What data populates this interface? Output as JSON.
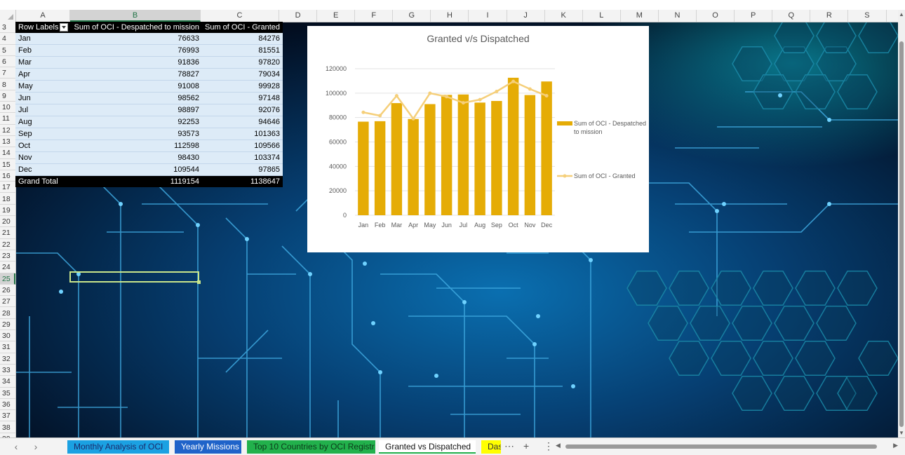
{
  "columns": [
    "A",
    "B",
    "C",
    "D",
    "E",
    "F",
    "G",
    "H",
    "I",
    "J",
    "K",
    "L",
    "M",
    "N",
    "O",
    "P",
    "Q",
    "R",
    "S"
  ],
  "rows": [
    "3",
    "4",
    "5",
    "6",
    "7",
    "8",
    "9",
    "10",
    "11",
    "12",
    "13",
    "14",
    "15",
    "16",
    "17",
    "18",
    "19",
    "20",
    "21",
    "22",
    "23",
    "24",
    "25",
    "26",
    "27",
    "28",
    "29",
    "30",
    "31",
    "32",
    "33",
    "34",
    "35",
    "36",
    "37",
    "38",
    "39"
  ],
  "selected_column": "B",
  "selected_row": "25",
  "pivot": {
    "headers": [
      "Row Labels",
      "Sum of OCI - Despatched to mission",
      "Sum of OCI - Granted"
    ],
    "rows": [
      {
        "label": "Jan",
        "despatched": "76633",
        "granted": "84276"
      },
      {
        "label": "Feb",
        "despatched": "76993",
        "granted": "81551"
      },
      {
        "label": "Mar",
        "despatched": "91836",
        "granted": "97820"
      },
      {
        "label": "Apr",
        "despatched": "78827",
        "granted": "79034"
      },
      {
        "label": "May",
        "despatched": "91008",
        "granted": "99928"
      },
      {
        "label": "Jun",
        "despatched": "98562",
        "granted": "97148"
      },
      {
        "label": "Jul",
        "despatched": "98897",
        "granted": "92076"
      },
      {
        "label": "Aug",
        "despatched": "92253",
        "granted": "94646"
      },
      {
        "label": "Sep",
        "despatched": "93573",
        "granted": "101363"
      },
      {
        "label": "Oct",
        "despatched": "112598",
        "granted": "109566"
      },
      {
        "label": "Nov",
        "despatched": "98430",
        "granted": "103374"
      },
      {
        "label": "Dec",
        "despatched": "109544",
        "granted": "97865"
      }
    ],
    "total": {
      "label": "Grand Total",
      "despatched": "1119154",
      "granted": "1138647"
    }
  },
  "chart_data": {
    "type": "bar",
    "title": "Granted v/s Dispatched",
    "categories": [
      "Jan",
      "Feb",
      "Mar",
      "Apr",
      "May",
      "Jun",
      "Jul",
      "Aug",
      "Sep",
      "Oct",
      "Nov",
      "Dec"
    ],
    "series": [
      {
        "name": "Sum of OCI - Despatched to mission",
        "kind": "bar",
        "color": "#e5ac06",
        "values": [
          76633,
          76993,
          91836,
          78827,
          91008,
          98562,
          98897,
          92253,
          93573,
          112598,
          98430,
          109544
        ]
      },
      {
        "name": "Sum of OCI - Granted",
        "kind": "line",
        "color": "#f5cf7a",
        "values": [
          84276,
          81551,
          97820,
          79034,
          99928,
          97148,
          92076,
          94646,
          101363,
          109566,
          103374,
          97865
        ]
      }
    ],
    "ylim": [
      0,
      120000
    ],
    "yticks": [
      0,
      20000,
      40000,
      60000,
      80000,
      100000,
      120000
    ],
    "grid": true,
    "legend": "right"
  },
  "tabs": [
    {
      "label": "Monthly Analysis of OCI",
      "style": "blue"
    },
    {
      "label": "Yearly Missions",
      "style": "navy"
    },
    {
      "label": "Top 10 Countries by OCI Registr",
      "style": "green"
    },
    {
      "label": "Granted vs Dispatched",
      "style": "active"
    },
    {
      "label": "Das",
      "style": "yellow"
    }
  ],
  "colors": {
    "accent": "#217346",
    "bar": "#e5ac06",
    "line": "#f5cf7a",
    "pivot_body": "#ddebf7"
  }
}
